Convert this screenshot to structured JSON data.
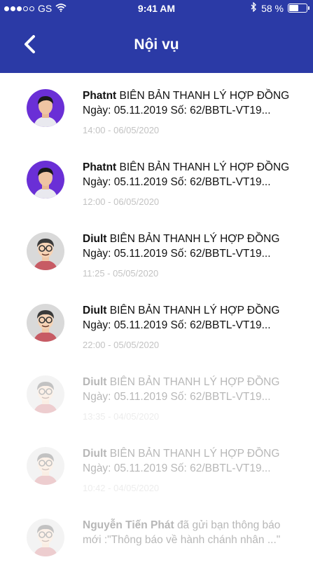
{
  "status_bar": {
    "carrier": "GS",
    "time": "9:41 AM",
    "battery": "58 %",
    "battery_level": 0.58
  },
  "header": {
    "title": "Nội vụ"
  },
  "notifications": [
    {
      "sender": "Phatnt",
      "line1": "BIÊN BẢN THANH LÝ HỢP ĐỒNG",
      "line2": "Ngày: 05.11.2019 Số: 62/BBTL-VT19...",
      "time": "14:00 - 06/05/2020",
      "avatar": "photo-avatar"
    },
    {
      "sender": "Phatnt",
      "line1": "BIÊN BẢN THANH LÝ HỢP ĐỒNG",
      "line2": "Ngày: 05.11.2019 Số: 62/BBTL-VT19...",
      "time": "12:00 - 06/05/2020",
      "avatar": "photo-avatar"
    },
    {
      "sender": "Diult",
      "line1": "BIÊN BẢN THANH LÝ HỢP ĐỒNG",
      "line2": "Ngày: 05.11.2019 Số: 62/BBTL-VT19...",
      "time": "11:25 - 05/05/2020",
      "avatar": "cartoon-avatar"
    },
    {
      "sender": "Diult",
      "line1": "BIÊN BẢN THANH LÝ HỢP ĐỒNG",
      "line2": "Ngày: 05.11.2019 Số: 62/BBTL-VT19...",
      "time": "22:00 - 05/05/2020",
      "avatar": "cartoon-avatar"
    },
    {
      "sender": "Diult",
      "line1": "BIÊN BẢN THANH LÝ HỢP ĐỒNG",
      "line2": "Ngày: 05.11.2019 Số: 62/BBTL-VT19...",
      "time": "13:35 - 04/05/2020",
      "avatar": "cartoon-avatar"
    },
    {
      "sender": "Diult",
      "line1": "BIÊN BẢN THANH LÝ HỢP ĐỒNG",
      "line2": "Ngày: 05.11.2019 Số: 62/BBTL-VT19...",
      "time": "10:42 - 04/05/2020",
      "avatar": "cartoon-avatar"
    },
    {
      "sender": "Nguyễn Tiến Phát",
      "line1": "đã gửi bạn thông báo",
      "line2": "mới :\"Thông báo về hành chánh nhân ...\"",
      "time": "",
      "avatar": "cartoon-avatar"
    }
  ],
  "colors": {
    "header_bg": "#2b3aa6",
    "photo_avatar_bg": "#6a2fd6",
    "cartoon_avatar_bg": "#d9d9d9",
    "timestamp": "#c3c3c3"
  }
}
